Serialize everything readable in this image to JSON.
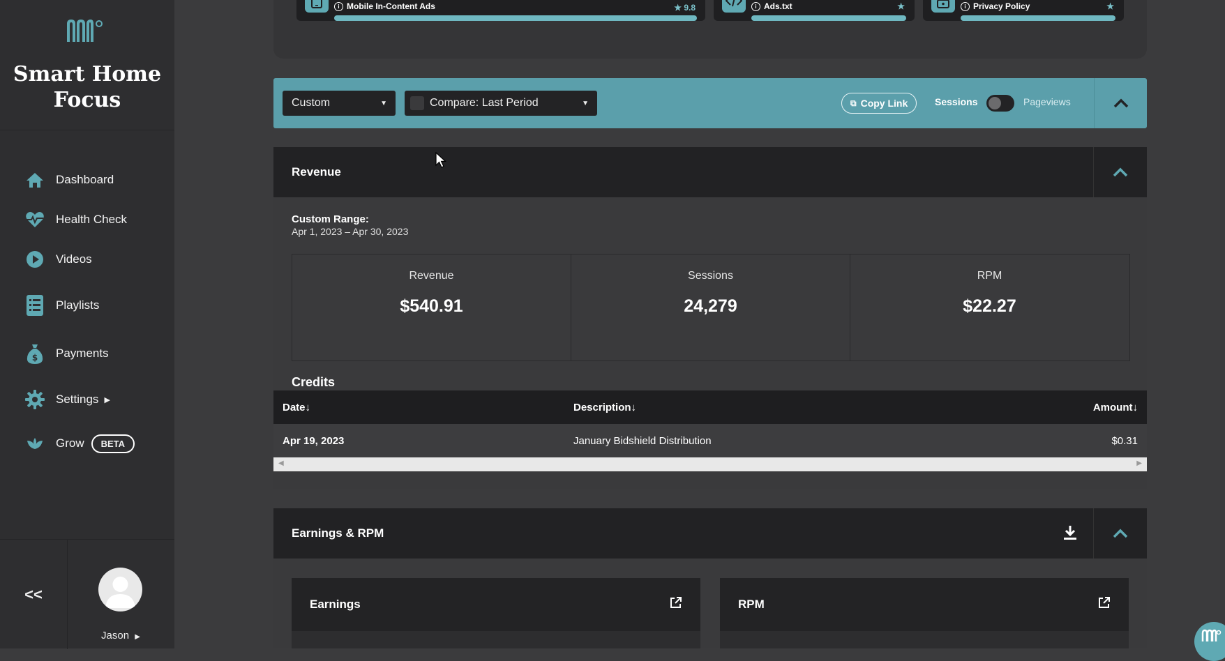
{
  "sidebar": {
    "site_title": "Smart Home Focus",
    "items": [
      {
        "label": "Dashboard",
        "icon": "home-icon"
      },
      {
        "label": "Health Check",
        "icon": "heartbeat-icon"
      },
      {
        "label": "Videos",
        "icon": "play-circle-icon"
      },
      {
        "label": "Playlists",
        "icon": "list-icon"
      },
      {
        "label": "Payments",
        "icon": "money-bag-icon"
      },
      {
        "label": "Settings",
        "icon": "gear-icon"
      },
      {
        "label": "Grow",
        "icon": "leaf-icon",
        "badge": "BETA"
      }
    ],
    "collapse_label": "<<",
    "user_name": "Jason"
  },
  "health_checks": [
    {
      "label": "Mobile In-Content Ads",
      "score": "9.8",
      "icon": "tablet-icon"
    },
    {
      "label": "Ads.txt",
      "score": "",
      "icon": "code-icon"
    },
    {
      "label": "Privacy Policy",
      "score": "",
      "icon": "lock-icon"
    }
  ],
  "toolbar": {
    "range_select": "Custom",
    "compare_select": "Compare: Last Period",
    "copy_link": "Copy Link",
    "toggle_left": "Sessions",
    "toggle_right": "Pageviews"
  },
  "revenue": {
    "title": "Revenue",
    "range_label": "Custom Range:",
    "range_value": "Apr 1, 2023 – Apr 30, 2023",
    "metrics": [
      {
        "label": "Revenue",
        "value": "$540.91"
      },
      {
        "label": "Sessions",
        "value": "24,279"
      },
      {
        "label": "RPM",
        "value": "$22.27"
      }
    ],
    "credits_title": "Credits",
    "columns": {
      "date": "Date↓",
      "description": "Description↓",
      "amount": "Amount↓"
    },
    "rows": [
      {
        "date": "Apr 19, 2023",
        "description": "January Bidshield Distribution",
        "amount": "$0.31"
      }
    ]
  },
  "earnings": {
    "title": "Earnings & RPM",
    "cards": [
      "Earnings",
      "RPM"
    ]
  },
  "colors": {
    "accent": "#5b9fab",
    "sidebar": "#2e2e30",
    "panel": "#222224"
  }
}
